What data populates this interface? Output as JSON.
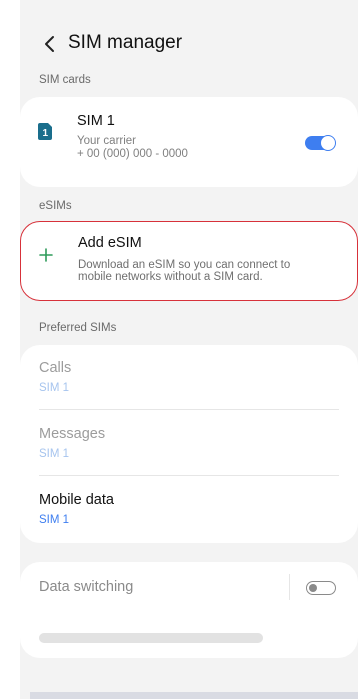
{
  "header": {
    "title": "SIM manager"
  },
  "sim_cards": {
    "section_label": "SIM cards",
    "sim1": {
      "name": "SIM 1",
      "carrier": "Your carrier",
      "number": "+ 00 (000) 000 - 0000",
      "enabled": true
    }
  },
  "esims": {
    "section_label": "eSIMs",
    "add": {
      "title": "Add eSIM",
      "description_line1": "Download an eSIM so you can connect to",
      "description_line2": "mobile networks without a SIM card."
    }
  },
  "preferred_sims": {
    "section_label": "Preferred SIMs",
    "items": [
      {
        "title": "Calls",
        "value": "SIM 1",
        "enabled": false
      },
      {
        "title": "Messages",
        "value": "SIM 1",
        "enabled": false
      },
      {
        "title": "Mobile data",
        "value": "SIM 1",
        "enabled": true
      }
    ]
  },
  "data_switching": {
    "title": "Data switching",
    "enabled": false
  },
  "colors": {
    "accent": "#3e7ef0",
    "highlight_border": "#d7313a",
    "sim_chip": "#1a6e8c",
    "plus": "#2e9b5a",
    "disabled_text": "#9c9c9c",
    "disabled_link": "#a6c4ee"
  },
  "icons": {
    "back": "chevron-left-icon",
    "sim": "sim-card-icon",
    "add": "plus-icon"
  }
}
